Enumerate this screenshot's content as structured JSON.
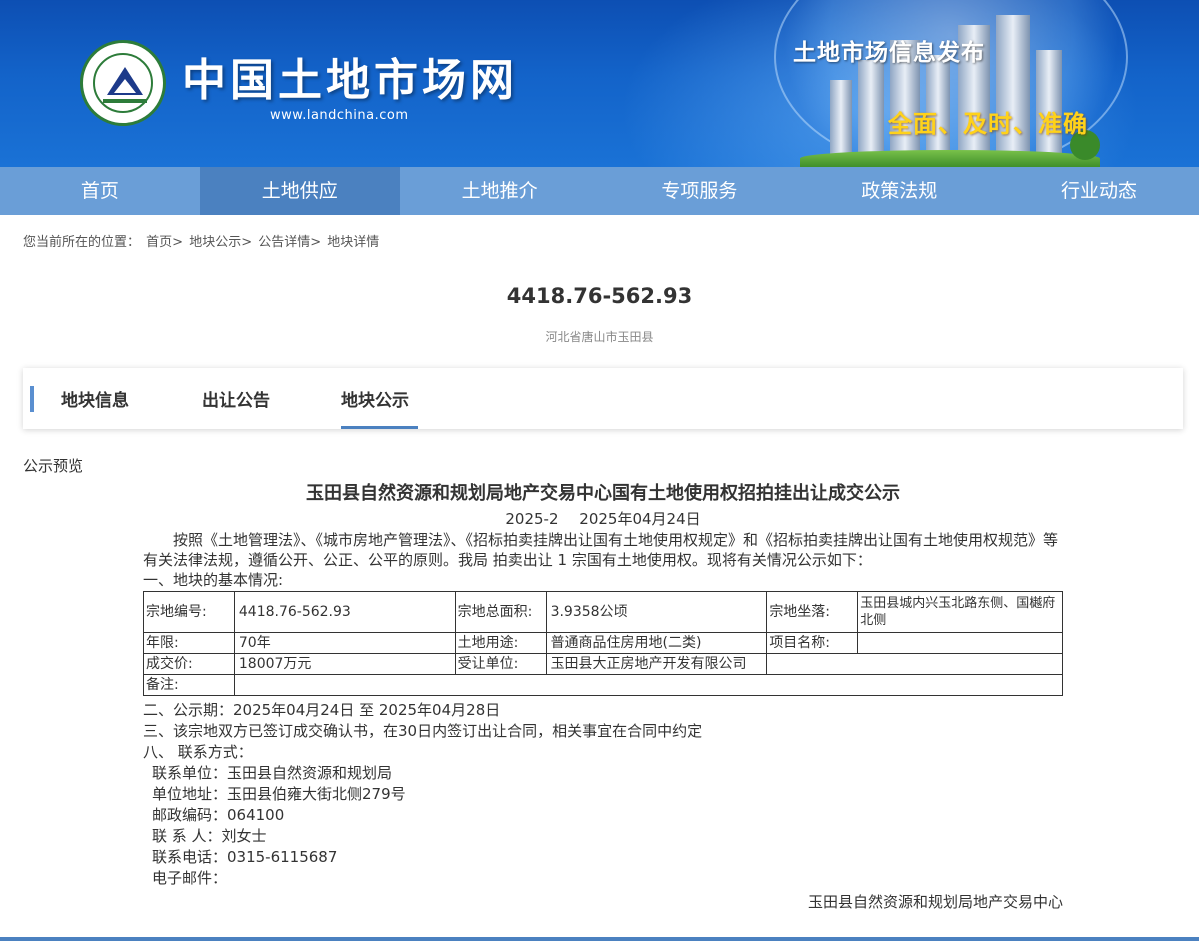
{
  "header": {
    "site_title": "中国土地市场网",
    "site_url": "www.landchina.com",
    "logo_text": "中国土地市场网 WWW.LANDCHINA.COM",
    "slogan_main": "土地市场信息发布",
    "slogan_sub": "全面、及时、准确"
  },
  "nav": {
    "items": [
      "首页",
      "土地供应",
      "土地推介",
      "专项服务",
      "政策法规",
      "行业动态"
    ],
    "active": "土地供应"
  },
  "breadcrumb": {
    "prefix": "您当前所在的位置：",
    "items": [
      "首页>",
      "地块公示>",
      "公告详情>",
      "地块详情"
    ]
  },
  "parcel": {
    "id": "4418.76-562.93",
    "location": "河北省唐山市玉田县"
  },
  "tabs": {
    "items": [
      "地块信息",
      "出让公告",
      "地块公示"
    ],
    "active": "地块公示"
  },
  "preview_label": "公示预览",
  "notice": {
    "title": "玉田县自然资源和规划局地产交易中心国有土地使用权招拍挂出让成交公示",
    "number": "2025-2",
    "date": "2025年04月24日",
    "intro": "按照《土地管理法》、《城市房地产管理法》、《招标拍卖挂牌出让国有土地使用权规定》和《招标拍卖挂牌出让国有土地使用权规范》等有关法律法规，遵循公开、公正、公平的原则。我局 拍卖出让 1 宗国有土地使用权。现将有关情况公示如下：",
    "section1": "一、地块的基本情况:",
    "table": {
      "row1": [
        "宗地编号:",
        "4418.76-562.93",
        "宗地总面积:",
        "3.9358公顷",
        "宗地坐落:",
        "玉田县城内兴玉北路东侧、国樾府北侧"
      ],
      "row2": [
        "年限:",
        "70年",
        "土地用途:",
        "普通商品住房用地(二类)",
        "项目名称:",
        ""
      ],
      "row3": [
        "成交价:",
        "18007万元",
        "受让单位:",
        "玉田县大正房地产开发有限公司"
      ],
      "row4": [
        "备注:",
        ""
      ]
    },
    "section2": "二、公示期：2025年04月24日 至 2025年04月28日",
    "section3": "三、该宗地双方已签订成交确认书，在30日内签订出让合同，相关事宜在合同中约定",
    "section8": "八、 联系方式：",
    "contacts": [
      "联系单位：玉田县自然资源和规划局",
      "单位地址：玉田县伯雍大街北侧279号",
      "邮政编码：064100",
      "联 系 人：刘女士",
      "联系电话：0315-6115687",
      "电子邮件："
    ],
    "signature": "玉田县自然资源和规划局地产交易中心"
  }
}
